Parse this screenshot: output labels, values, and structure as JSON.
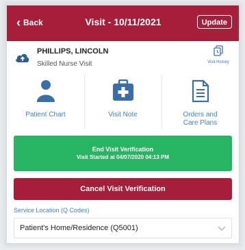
{
  "header": {
    "back_label": "Back",
    "title": "Visit - 10/11/2021",
    "update_label": "Update"
  },
  "patient": {
    "name": "PHILLIPS, LINCOLN",
    "visit_type": "Skilled Nurse Visit",
    "history_label": "Visit History"
  },
  "actions": [
    {
      "label": "Patient Chart",
      "icon": "person-icon"
    },
    {
      "label": "Visit Note",
      "icon": "medical-kit-icon"
    },
    {
      "label": "Orders and Care Plans",
      "icon": "document-icon"
    }
  ],
  "end_visit": {
    "line1": "End Visit Verification",
    "line2": "Visit Started at 04/07/2020 04:13 PM"
  },
  "cancel_label": "Cancel Visit Verification",
  "service_location": {
    "label": "Service Location (Q Codes)",
    "value": "Patient's Home/Residence (Q5001)"
  },
  "colors": {
    "brand": "#a51f3a",
    "success": "#28b463",
    "link": "#3c7fd4"
  }
}
